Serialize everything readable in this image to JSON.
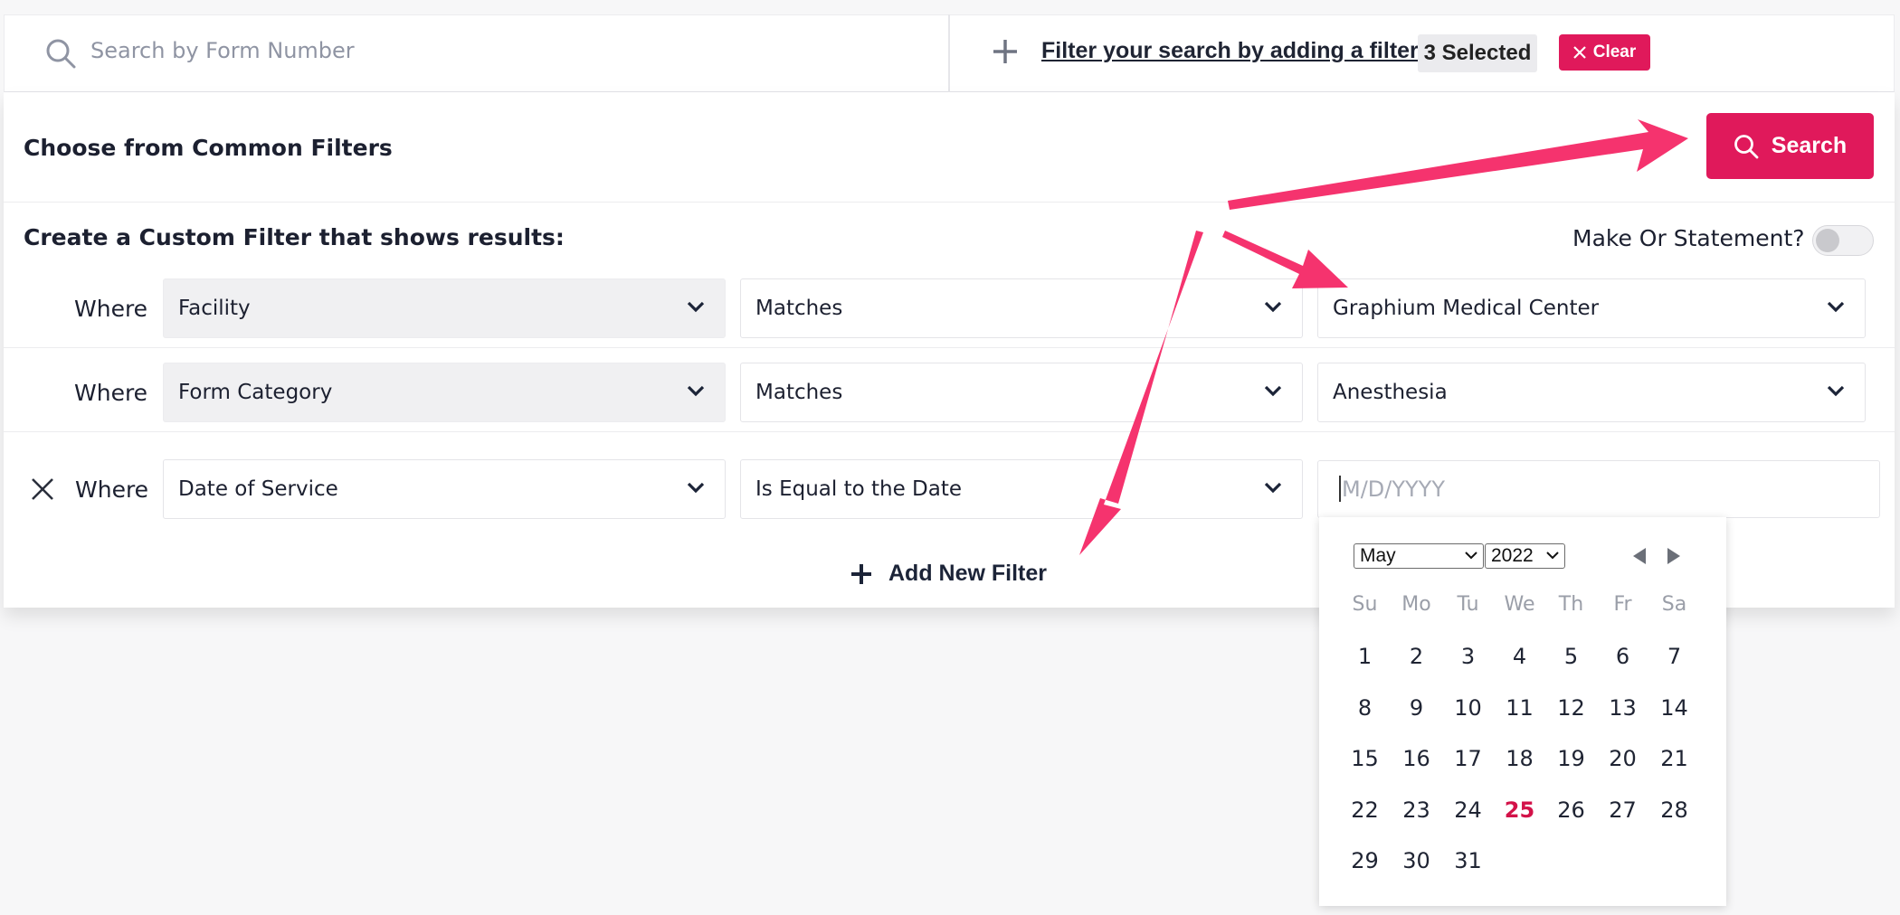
{
  "search": {
    "placeholder": "Search by Form Number"
  },
  "filter_bar": {
    "add_filter_link": "Filter your search by adding a filter",
    "selected_badge": "3 Selected",
    "clear_label": "Clear"
  },
  "panel": {
    "common_heading": "Choose from Common Filters",
    "search_button": "Search",
    "custom_heading": "Create a Custom Filter that shows results:",
    "or_statement_label": "Make Or Statement?",
    "or_statement_on": false,
    "add_new_filter": "Add New Filter"
  },
  "filters": [
    {
      "where": "Where",
      "field": "Facility",
      "operator": "Matches",
      "value": "Graphium Medical Center"
    },
    {
      "where": "Where",
      "field": "Form Category",
      "operator": "Matches",
      "value": "Anesthesia"
    },
    {
      "where": "Where",
      "field": "Date of Service",
      "operator": "Is Equal to the Date",
      "value_placeholder": "M/D/YYYY"
    }
  ],
  "calendar": {
    "month": "May",
    "year": "2022",
    "weekdays": [
      "Su",
      "Mo",
      "Tu",
      "We",
      "Th",
      "Fr",
      "Sa"
    ],
    "first_weekday_index": 0,
    "days_in_month": 31,
    "highlighted_day": 25
  },
  "colors": {
    "accent": "#e0195b",
    "annotation_arrow": "#f5336e",
    "today_text": "#d31249"
  }
}
